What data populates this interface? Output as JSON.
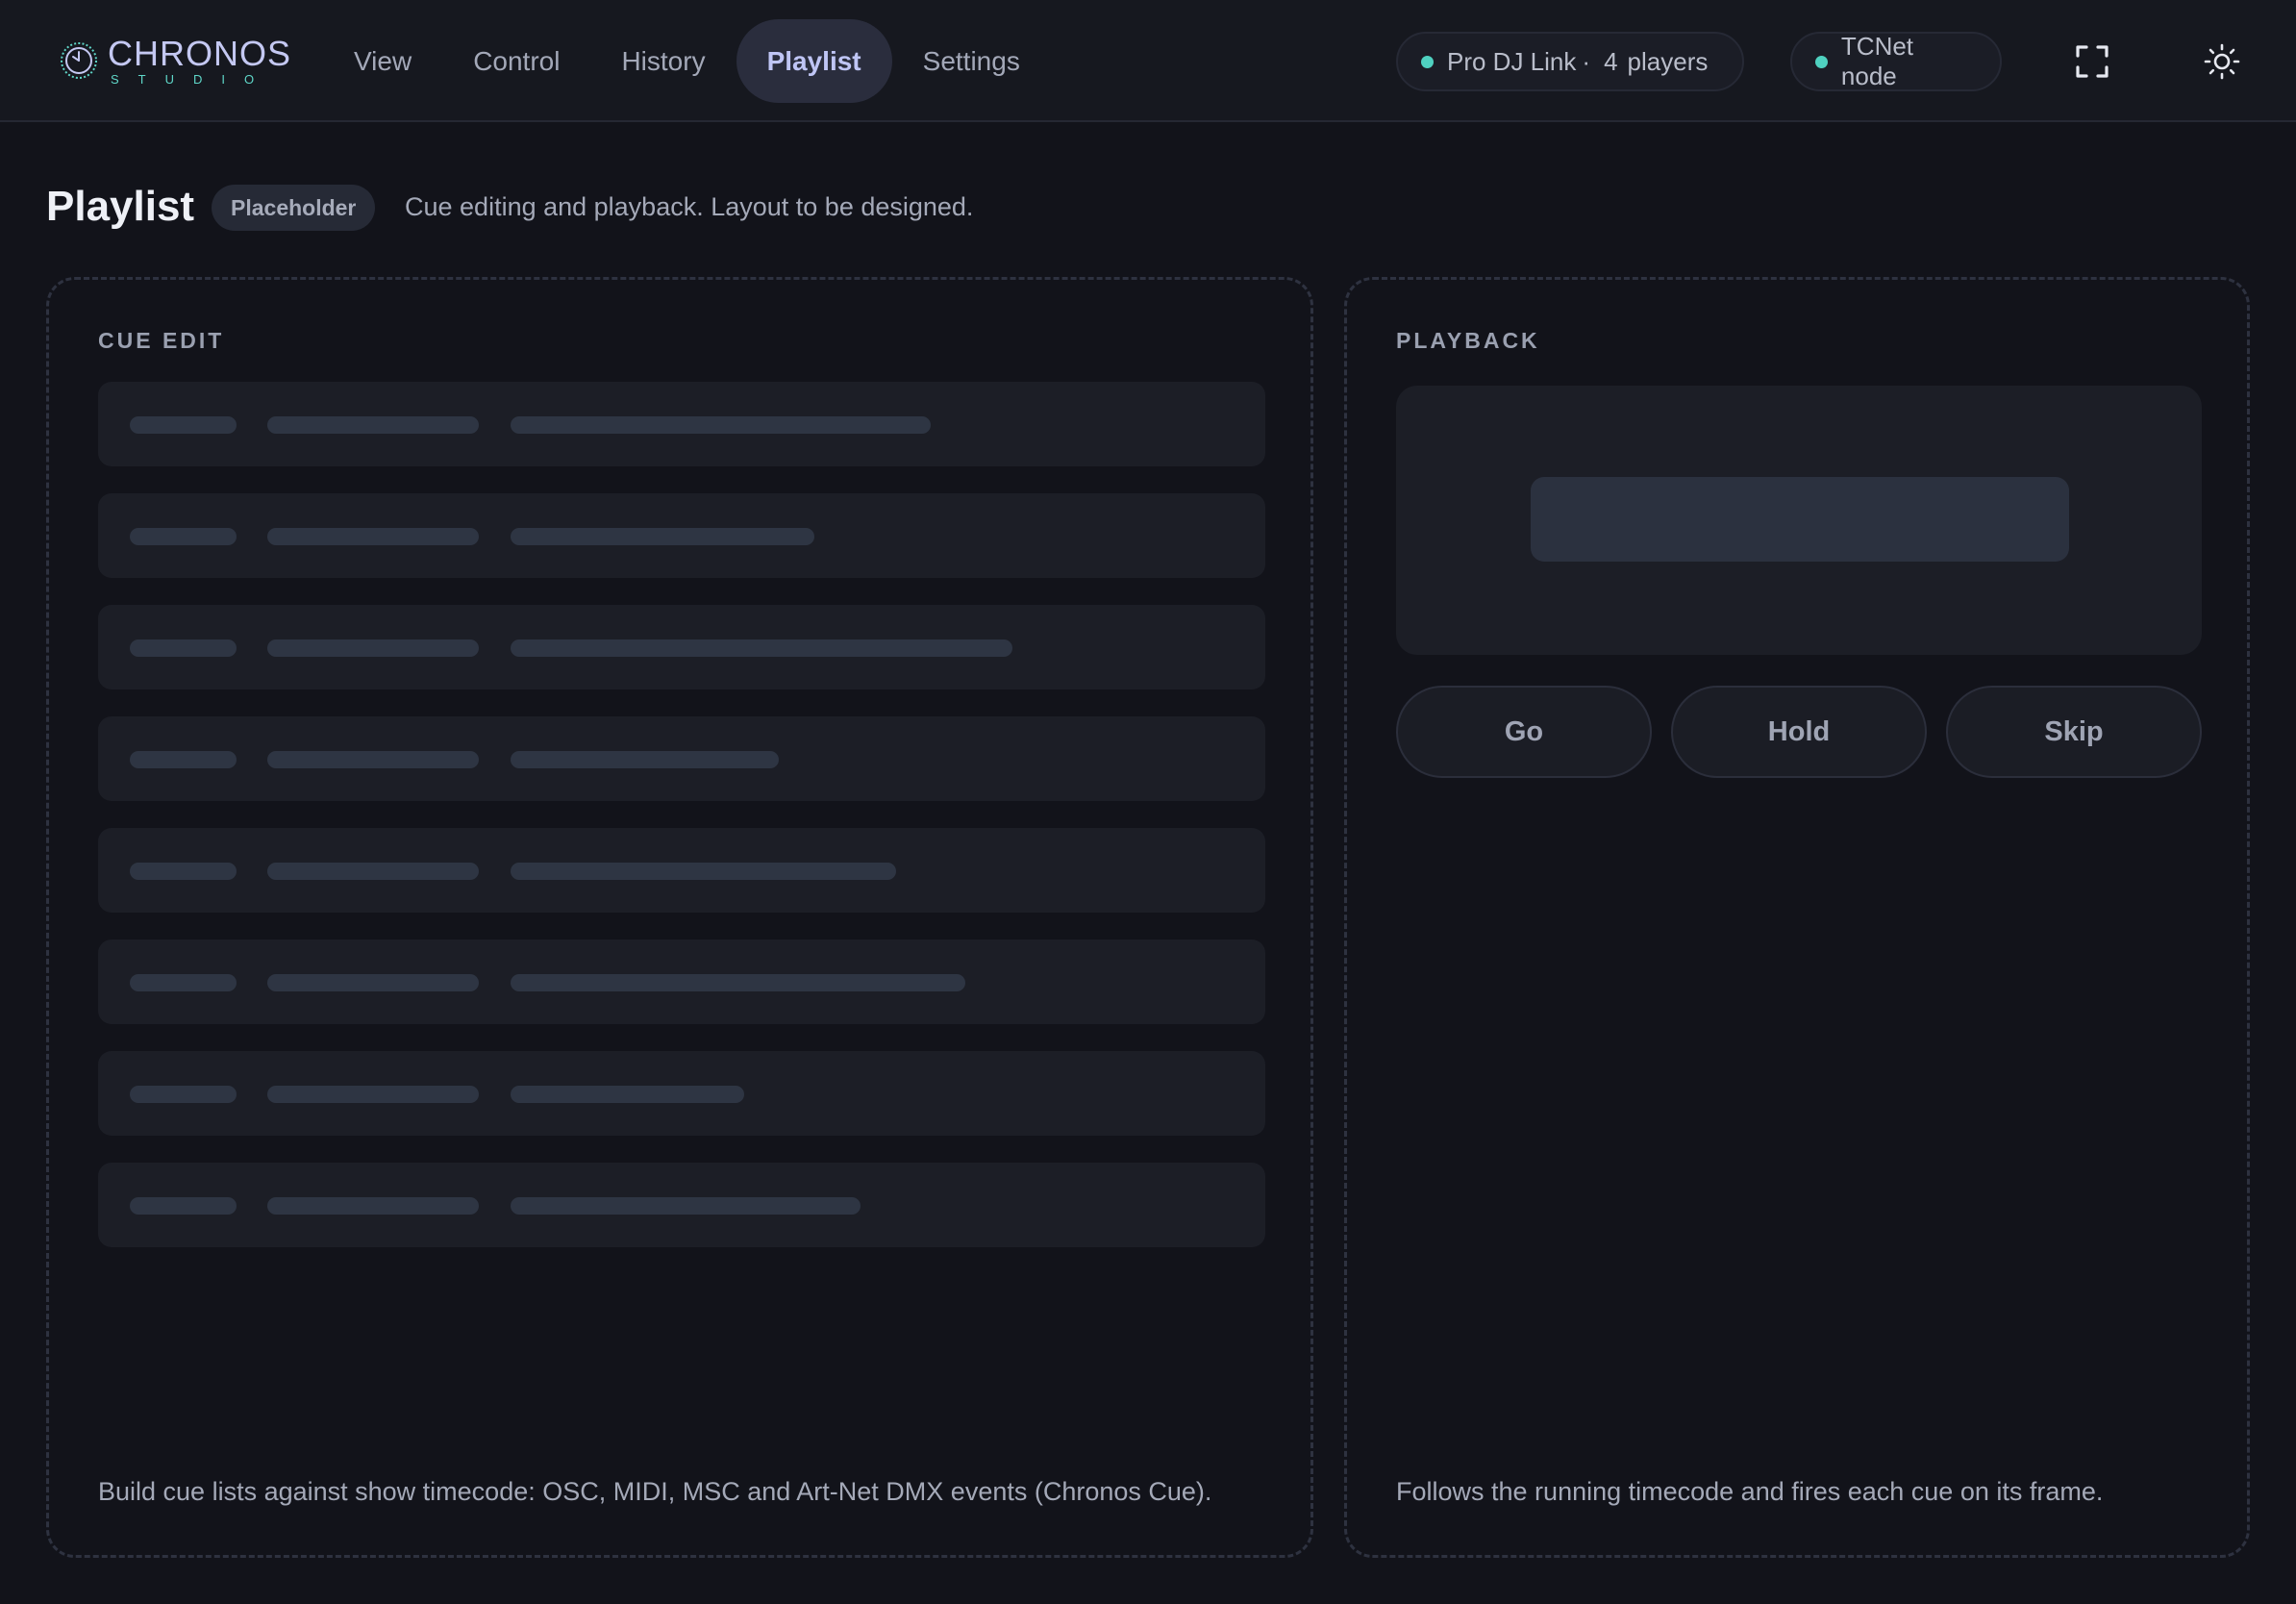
{
  "app": {
    "logo_main": "CHRONOS",
    "logo_sub": "STUDIO",
    "accent": "#c4c8f2",
    "teal": "#5fd6c8"
  },
  "nav": {
    "items": [
      {
        "label": "View",
        "active": false
      },
      {
        "label": "Control",
        "active": false
      },
      {
        "label": "History",
        "active": false
      },
      {
        "label": "Playlist",
        "active": true
      },
      {
        "label": "Settings",
        "active": false
      }
    ]
  },
  "status": {
    "djlink": {
      "label": "Pro DJ Link",
      "separator": "·",
      "count": "4",
      "unit": "players",
      "color": "#4fd1c0"
    },
    "tcnet": {
      "label": "TCNet node",
      "color": "#4fd1c0"
    }
  },
  "toolbar": {
    "fullscreen_icon": "fullscreen-icon",
    "theme_icon": "sun-icon"
  },
  "page": {
    "title": "Playlist",
    "badge": "Placeholder",
    "subtitle": "Cue editing and playback. Layout to be designed."
  },
  "cue_edit": {
    "label": "CUE EDIT",
    "rows": [
      {
        "detail_fraction": 0.36
      },
      {
        "detail_fraction": 0.26
      },
      {
        "detail_fraction": 0.43
      },
      {
        "detail_fraction": 0.23
      },
      {
        "detail_fraction": 0.33
      },
      {
        "detail_fraction": 0.39
      },
      {
        "detail_fraction": 0.2
      },
      {
        "detail_fraction": 0.3
      }
    ],
    "footer": "Build cue lists against show timecode: OSC, MIDI, MSC and Art-Net DMX events (Chronos Cue)."
  },
  "playback": {
    "label": "PLAYBACK",
    "buttons": [
      {
        "label": "Go"
      },
      {
        "label": "Hold"
      },
      {
        "label": "Skip"
      }
    ],
    "footer": "Follows the running timecode and fires each cue on its frame."
  }
}
